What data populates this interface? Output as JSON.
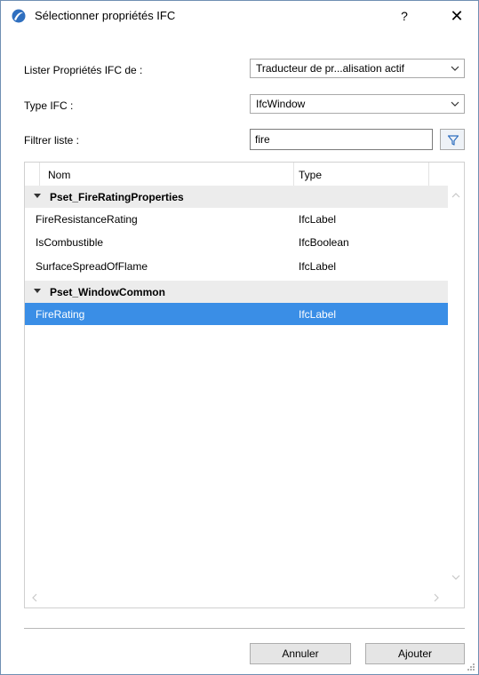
{
  "window": {
    "title": "Sélectionner propriétés IFC",
    "help_label": "?",
    "close_label": "✕"
  },
  "form": {
    "source_label": "Lister Propriétés IFC de :",
    "source_value": "Traducteur de pr...alisation actif",
    "type_label": "Type IFC :",
    "type_value": "IfcWindow",
    "filter_label": "Filtrer liste :",
    "filter_value": "fire"
  },
  "list": {
    "columns": [
      "Nom",
      "Type"
    ],
    "groups": [
      {
        "name": "Pset_FireRatingProperties",
        "items": [
          {
            "name": "FireResistanceRating",
            "type": "IfcLabel"
          },
          {
            "name": "IsCombustible",
            "type": "IfcBoolean"
          },
          {
            "name": "SurfaceSpreadOfFlame",
            "type": "IfcLabel"
          }
        ]
      },
      {
        "name": "Pset_WindowCommon",
        "items": [
          {
            "name": "FireRating",
            "type": "IfcLabel",
            "selected": true
          }
        ]
      }
    ]
  },
  "buttons": {
    "cancel": "Annuler",
    "add": "Ajouter"
  },
  "colors": {
    "selection": "#3a8ee6",
    "group_bg": "#ececec",
    "accent": "#2f6fbf"
  }
}
